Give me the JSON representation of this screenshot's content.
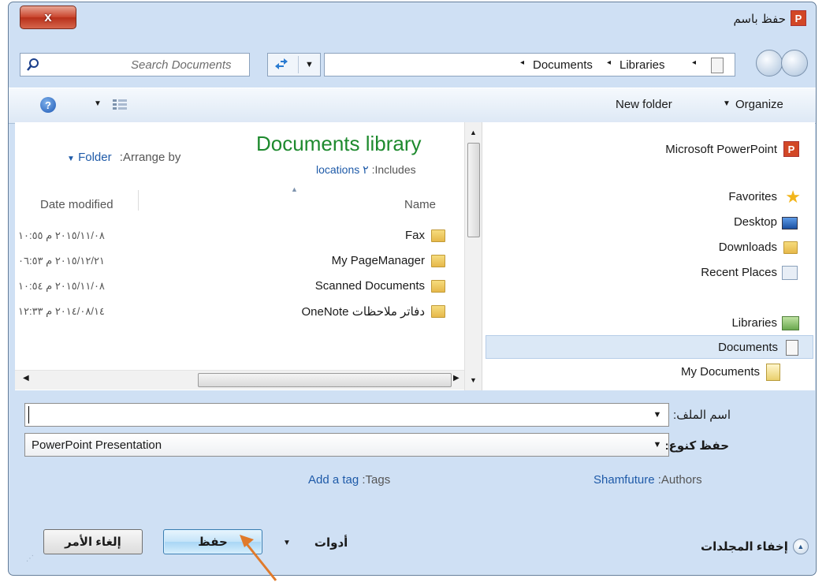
{
  "window": {
    "title": "حفظ باسم",
    "close_label": "x",
    "app_icon": "powerpoint-icon"
  },
  "address": {
    "search_placeholder": "Search Documents",
    "breadcrumb": [
      "Documents",
      "Libraries"
    ],
    "separator": "◂"
  },
  "toolbar": {
    "new_folder": "New folder",
    "organize": "Organize"
  },
  "library": {
    "title": "Documents library",
    "includes_label": ":Includes",
    "includes_value": "locations ٢",
    "arrange_label": ":Arrange by",
    "arrange_value": "Folder"
  },
  "columns": {
    "name": "Name",
    "date_modified": "Date modified"
  },
  "files": [
    {
      "name": "Fax",
      "date": "٢٠١٥/١١/٠٨ م ١٠:٥٥"
    },
    {
      "name": "My PageManager",
      "date": "٢٠١٥/١٢/٢١ م ٠٦:٥٣"
    },
    {
      "name": "Scanned Documents",
      "date": "٢٠١٥/١١/٠٨ م ١٠:٥٤"
    },
    {
      "name": "OneNote دفاتر ملاحظات",
      "date": "٢٠١٤/٠٨/١٤ م ١٢:٣٣"
    }
  ],
  "nav": {
    "app": "Microsoft PowerPoint",
    "favorites": "Favorites",
    "desktop": "Desktop",
    "downloads": "Downloads",
    "recent_places": "Recent Places",
    "libraries": "Libraries",
    "documents": "Documents",
    "my_documents": "My Documents"
  },
  "form": {
    "filename_label": "اسم الملف:",
    "filename_value": "",
    "savetype_label": "حفظ كنوع:",
    "savetype_value": "PowerPoint Presentation",
    "authors_label": ":Authors",
    "authors_value": "Shamfuture",
    "tags_label": ":Tags",
    "tags_value": "Add a tag"
  },
  "footer": {
    "hide_folders": "إخفاء المجلدات",
    "tools": "أدوات",
    "save": "حفظ",
    "cancel": "إلغاء الأمر"
  },
  "colors": {
    "library_title": "#1e8a2e",
    "link": "#1e5aa8",
    "selection": "#dbe8f6",
    "arrow": "#e07a2b"
  }
}
